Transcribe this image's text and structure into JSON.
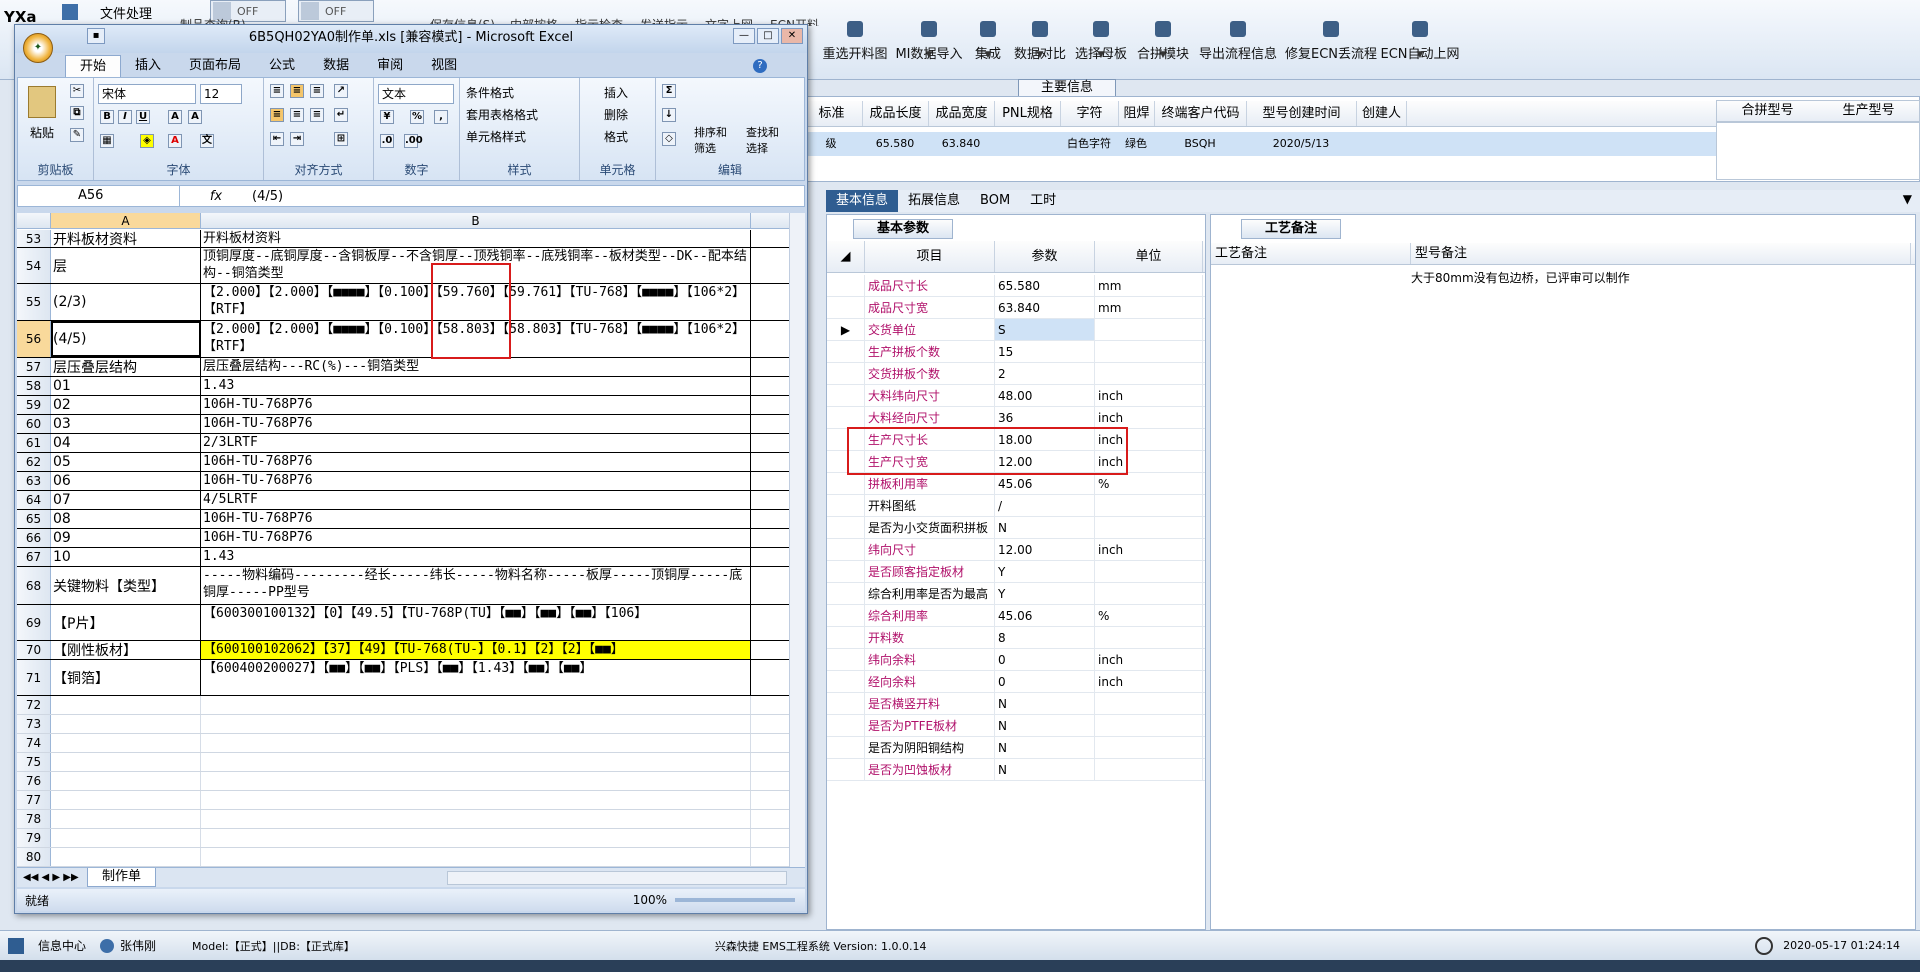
{
  "app": {
    "toolbar": [
      "重选开料图",
      "MI数据导入",
      "集成",
      "数据对比",
      "选择母板",
      "合拼模块",
      "导出流程信息",
      "修复ECN丢流程",
      "ECN自动上网"
    ],
    "partial_left": [
      "制品查询(R)",
      "保存信息(S)",
      "内部按格",
      "指示检查",
      "发送指示",
      "文字上网",
      "ECN开料"
    ],
    "file_menu": "文件处理",
    "yx": "YXa",
    "toggles": [
      "OFF",
      "OFF"
    ],
    "main_info_title": "主要信息",
    "info_headers": [
      "标准",
      "成品长度",
      "成品宽度",
      "PNL规格",
      "字符",
      "阻焊",
      "终端客户代码",
      "型号创建时间",
      "创建人"
    ],
    "info_row": [
      "级",
      "65.580",
      "63.840",
      "",
      "白色字符",
      "绿色",
      "BSQH",
      "2020/5/13",
      ""
    ],
    "merge_headers": [
      "合拼型号",
      "生产型号"
    ],
    "tabs": [
      "基本信息",
      "拓展信息",
      "BOM",
      "工时"
    ],
    "param_title": "基本参数",
    "param_headers": [
      "项目",
      "参数",
      "单位"
    ],
    "params": [
      {
        "item": "成品尺寸长",
        "val": "65.580",
        "unit": "mm",
        "red": true,
        "mark": ""
      },
      {
        "item": "成品尺寸宽",
        "val": "63.840",
        "unit": "mm",
        "red": true,
        "mark": ""
      },
      {
        "item": "交货单位",
        "val": "S",
        "unit": "",
        "red": true,
        "mark": "▶"
      },
      {
        "item": "生产拼板个数",
        "val": "15",
        "unit": "",
        "red": true,
        "mark": ""
      },
      {
        "item": "交货拼板个数",
        "val": "2",
        "unit": "",
        "red": true,
        "mark": ""
      },
      {
        "item": "大料纬向尺寸",
        "val": "48.00",
        "unit": "inch",
        "red": true,
        "mark": ""
      },
      {
        "item": "大料经向尺寸",
        "val": "36",
        "unit": "inch",
        "red": true,
        "mark": ""
      },
      {
        "item": "生产尺寸长",
        "val": "18.00",
        "unit": "inch",
        "red": true,
        "mark": ""
      },
      {
        "item": "生产尺寸宽",
        "val": "12.00",
        "unit": "inch",
        "red": true,
        "mark": ""
      },
      {
        "item": "拼板利用率",
        "val": "45.06",
        "unit": "%",
        "red": true,
        "mark": ""
      },
      {
        "item": "开料图纸",
        "val": "/",
        "unit": "",
        "red": false,
        "mark": ""
      },
      {
        "item": "是否为小交货面积拼板",
        "val": "N",
        "unit": "",
        "red": false,
        "mark": ""
      },
      {
        "item": "纬向尺寸",
        "val": "12.00",
        "unit": "inch",
        "red": true,
        "mark": ""
      },
      {
        "item": "是否顾客指定板材",
        "val": "Y",
        "unit": "",
        "red": true,
        "mark": ""
      },
      {
        "item": "综合利用率是否为最高",
        "val": "Y",
        "unit": "",
        "red": false,
        "mark": ""
      },
      {
        "item": "综合利用率",
        "val": "45.06",
        "unit": "%",
        "red": true,
        "mark": ""
      },
      {
        "item": "开料数",
        "val": "8",
        "unit": "",
        "red": true,
        "mark": ""
      },
      {
        "item": "纬向余料",
        "val": "0",
        "unit": "inch",
        "red": true,
        "mark": ""
      },
      {
        "item": "经向余料",
        "val": "0",
        "unit": "inch",
        "red": true,
        "mark": ""
      },
      {
        "item": "是否横竖开料",
        "val": "N",
        "unit": "",
        "red": true,
        "mark": ""
      },
      {
        "item": "是否为PTFE板材",
        "val": "N",
        "unit": "",
        "red": true,
        "mark": ""
      },
      {
        "item": "是否为阴阳铜结构",
        "val": "N",
        "unit": "",
        "red": false,
        "mark": ""
      },
      {
        "item": "是否为凹蚀板材",
        "val": "N",
        "unit": "",
        "red": true,
        "mark": ""
      }
    ],
    "craft_title": "工艺备注",
    "craft_headers": [
      "工艺备注",
      "型号备注"
    ],
    "craft_note": "大于80mm没有包边桥，已评审可以制作",
    "status": {
      "info_center": "信息中心",
      "user": "张伟刚",
      "model": "Model:【正式】||DB:【正式库】",
      "system": "兴森快捷 EMS工程系统 Version: 1.0.0.14",
      "datetime": "2020-05-17 01:24:14"
    }
  },
  "excel": {
    "title": "6B5QH02YA0制作单.xls [兼容模式] - Microsoft Excel",
    "ribbon_tabs": [
      "开始",
      "插入",
      "页面布局",
      "公式",
      "数据",
      "审阅",
      "视图"
    ],
    "font_name": "宋体",
    "font_size": "12",
    "number_format": "文本",
    "groups": [
      "剪贴板",
      "字体",
      "对齐方式",
      "数字",
      "样式",
      "单元格",
      "编辑"
    ],
    "styles": [
      "条件格式",
      "套用表格格式",
      "单元格样式"
    ],
    "cells": [
      "插入",
      "删除",
      "格式"
    ],
    "edit": [
      "排序和筛选",
      "查找和选择"
    ],
    "paste": "粘贴",
    "name_box": "A56",
    "formula": "(4/5)",
    "col_a": "A",
    "col_b": "B",
    "rows": [
      {
        "n": "53",
        "a": "开料板材资料",
        "b": "开料板材资料",
        "h": 18,
        "y": false
      },
      {
        "n": "54",
        "a": "层",
        "b": "顶铜厚度--底铜厚度--含铜板厚--不含铜厚--顶残铜率--底残铜率--板材类型--DK--配本结构--铜箔类型",
        "h": 36,
        "y": false
      },
      {
        "n": "55",
        "a": "(2/3)",
        "b": "【2.000】【2.000】【■■■■】【0.100】【59.760】【59.761】【TU-768】【■■■■】【106*2】【RTF】",
        "h": 37,
        "y": false
      },
      {
        "n": "56",
        "a": "(4/5)",
        "b": "【2.000】【2.000】【■■■■】【0.100】【58.803】【58.803】【TU-768】【■■■■】【106*2】【RTF】",
        "h": 37,
        "y": false
      },
      {
        "n": "57",
        "a": "层压叠层结构",
        "b": "层压叠层结构---RC(%)---铜箔类型",
        "h": 19,
        "y": false
      },
      {
        "n": "58",
        "a": "01",
        "b": "1.43",
        "h": 19,
        "y": false
      },
      {
        "n": "59",
        "a": "02",
        "b": "106H-TU-768P76",
        "h": 19,
        "y": false
      },
      {
        "n": "60",
        "a": "03",
        "b": "106H-TU-768P76",
        "h": 19,
        "y": false
      },
      {
        "n": "61",
        "a": "04",
        "b": "2/3LRTF",
        "h": 19,
        "y": false
      },
      {
        "n": "62",
        "a": "05",
        "b": "106H-TU-768P76",
        "h": 19,
        "y": false
      },
      {
        "n": "63",
        "a": "06",
        "b": "106H-TU-768P76",
        "h": 19,
        "y": false
      },
      {
        "n": "64",
        "a": "07",
        "b": "4/5LRTF",
        "h": 19,
        "y": false
      },
      {
        "n": "65",
        "a": "08",
        "b": "106H-TU-768P76",
        "h": 19,
        "y": false
      },
      {
        "n": "66",
        "a": "09",
        "b": "106H-TU-768P76",
        "h": 19,
        "y": false
      },
      {
        "n": "67",
        "a": "10",
        "b": "1.43",
        "h": 19,
        "y": false
      },
      {
        "n": "68",
        "a": "关键物料【类型】",
        "b": "-----物料编码---------经长-----纬长-----物料名称-----板厚-----顶铜厚-----底铜厚-----PP型号",
        "h": 38,
        "y": false
      },
      {
        "n": "69",
        "a": "【P片】",
        "b": "【600300100132】【0】【49.5】【TU-768P(TU】【■■】【■■】【■■】【106】",
        "h": 36,
        "y": false
      },
      {
        "n": "70",
        "a": "【刚性板材】",
        "b": "【600100102062】【37】【49】【TU-768(TU-】【0.1】【2】【2】【■■】",
        "h": 19,
        "y": true
      },
      {
        "n": "71",
        "a": "【铜箔】",
        "b": "【600400200027】【■■】【■■】【PLS】【■■】【1.43】【■■】【■■】",
        "h": 36,
        "y": false
      },
      {
        "n": "72",
        "a": "",
        "b": "",
        "h": 19,
        "y": false
      },
      {
        "n": "73",
        "a": "",
        "b": "",
        "h": 19,
        "y": false
      },
      {
        "n": "74",
        "a": "",
        "b": "",
        "h": 19,
        "y": false
      },
      {
        "n": "75",
        "a": "",
        "b": "",
        "h": 19,
        "y": false
      },
      {
        "n": "76",
        "a": "",
        "b": "",
        "h": 19,
        "y": false
      },
      {
        "n": "77",
        "a": "",
        "b": "",
        "h": 19,
        "y": false
      },
      {
        "n": "78",
        "a": "",
        "b": "",
        "h": 19,
        "y": false
      },
      {
        "n": "79",
        "a": "",
        "b": "",
        "h": 19,
        "y": false
      },
      {
        "n": "80",
        "a": "",
        "b": "",
        "h": 19,
        "y": false
      }
    ],
    "sheet_tab": "制作单",
    "status": "就绪",
    "zoom": "100%"
  }
}
